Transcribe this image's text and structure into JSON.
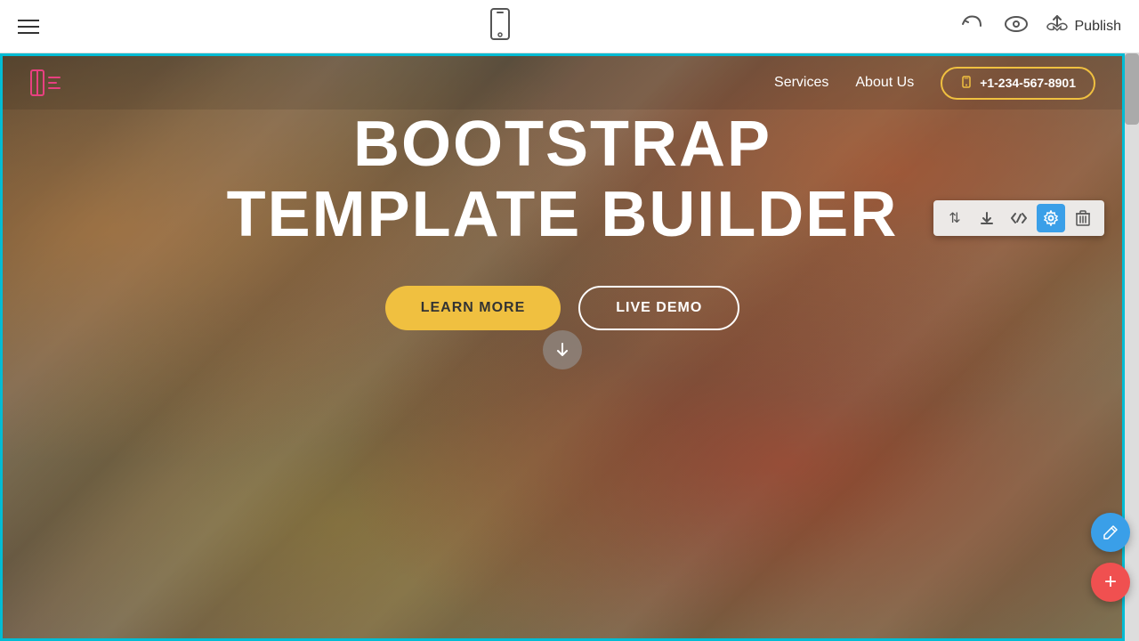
{
  "toolbar": {
    "publish_label": "Publish",
    "icons": {
      "hamburger": "☰",
      "mobile": "📱",
      "undo": "↩",
      "preview": "👁",
      "upload": "⬆"
    }
  },
  "nav": {
    "logo_alt": "Logo",
    "links": [
      {
        "label": "Services"
      },
      {
        "label": "About Us"
      }
    ],
    "phone": "+1-234-567-8901"
  },
  "hero": {
    "title_line1": "BOOTSTRAP",
    "title_line2": "TEMPLATE BUILDER",
    "btn_learn": "LEARN MORE",
    "btn_demo": "LIVE DEMO"
  },
  "section_tools": [
    {
      "id": "move",
      "icon": "⇅"
    },
    {
      "id": "download",
      "icon": "⬇"
    },
    {
      "id": "code",
      "icon": "</>"
    },
    {
      "id": "settings",
      "icon": "⚙"
    },
    {
      "id": "delete",
      "icon": "🗑"
    }
  ],
  "fab": {
    "edit_icon": "✏",
    "add_icon": "+"
  }
}
